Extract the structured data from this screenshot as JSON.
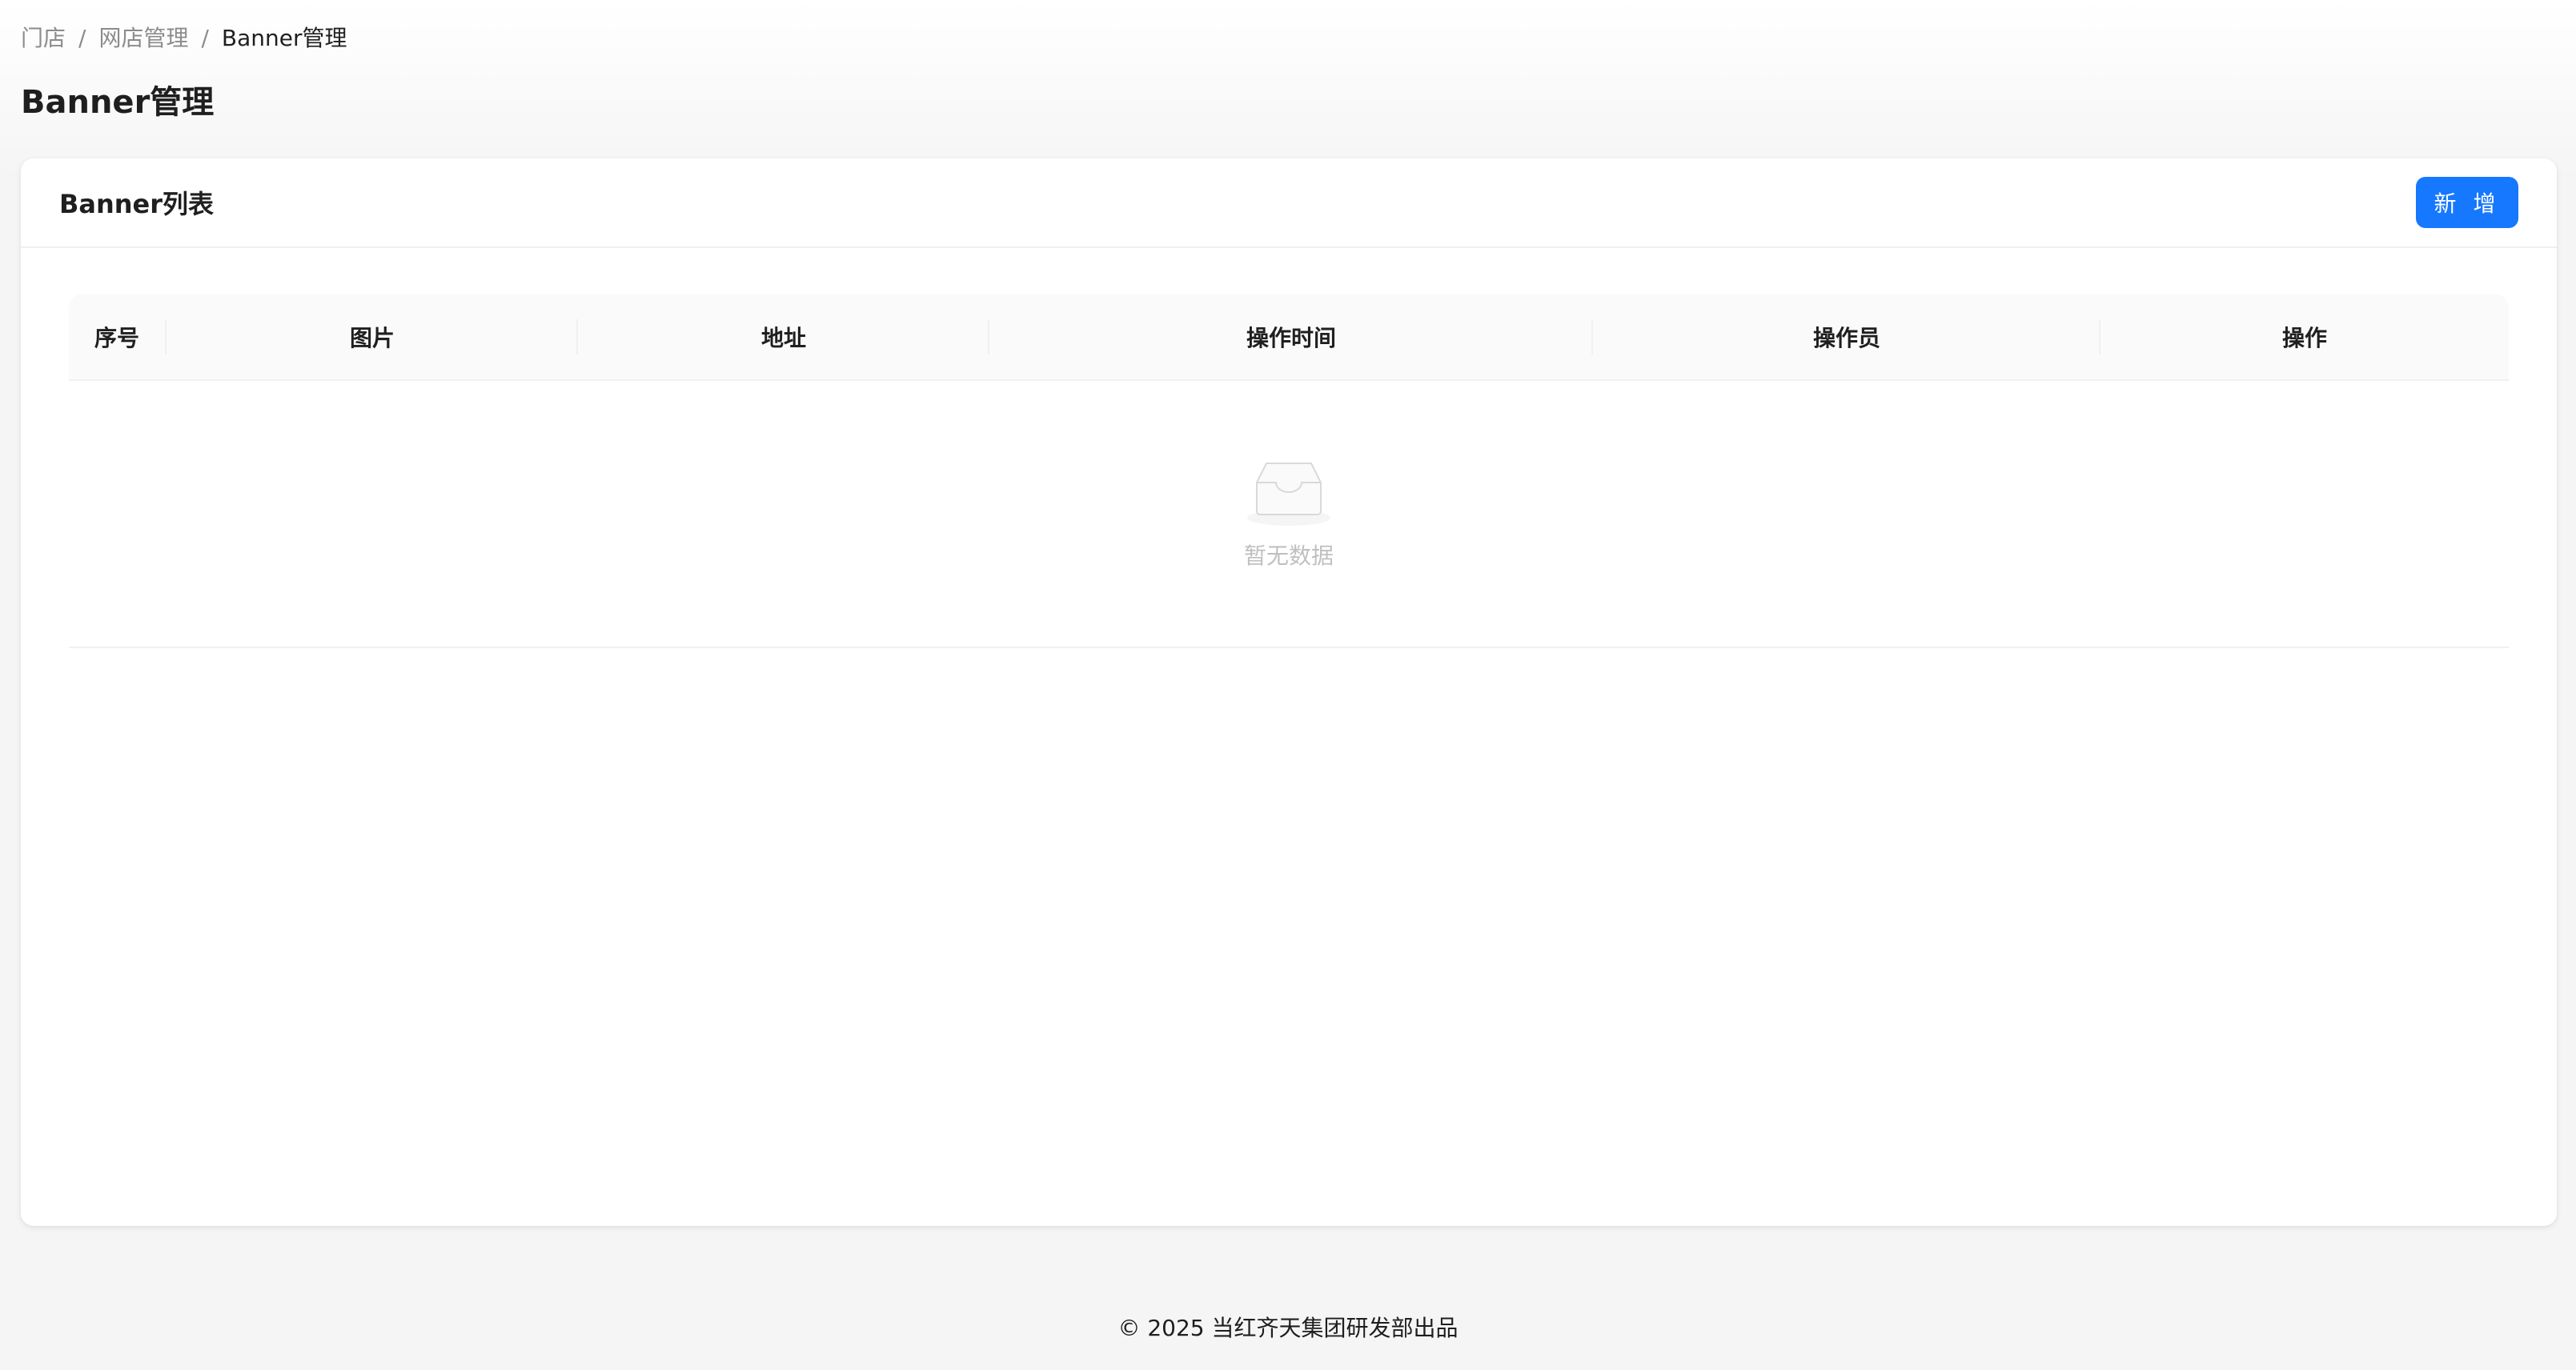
{
  "breadcrumb": {
    "items": [
      "门店",
      "网店管理",
      "Banner管理"
    ],
    "separator": "/"
  },
  "page": {
    "title": "Banner管理"
  },
  "card": {
    "title": "Banner列表",
    "add_button_label": "新 增"
  },
  "table": {
    "columns": [
      "序号",
      "图片",
      "地址",
      "操作时间",
      "操作员",
      "操作"
    ],
    "rows": [],
    "empty_text": "暂无数据"
  },
  "footer": {
    "copyright_symbol": "©",
    "text": "2025 当红齐天集团研发部出品"
  },
  "colors": {
    "primary": "#1677ff",
    "header_bg": "#fafafa",
    "border": "#f0f0f0",
    "page_bg": "#f5f5f5"
  }
}
